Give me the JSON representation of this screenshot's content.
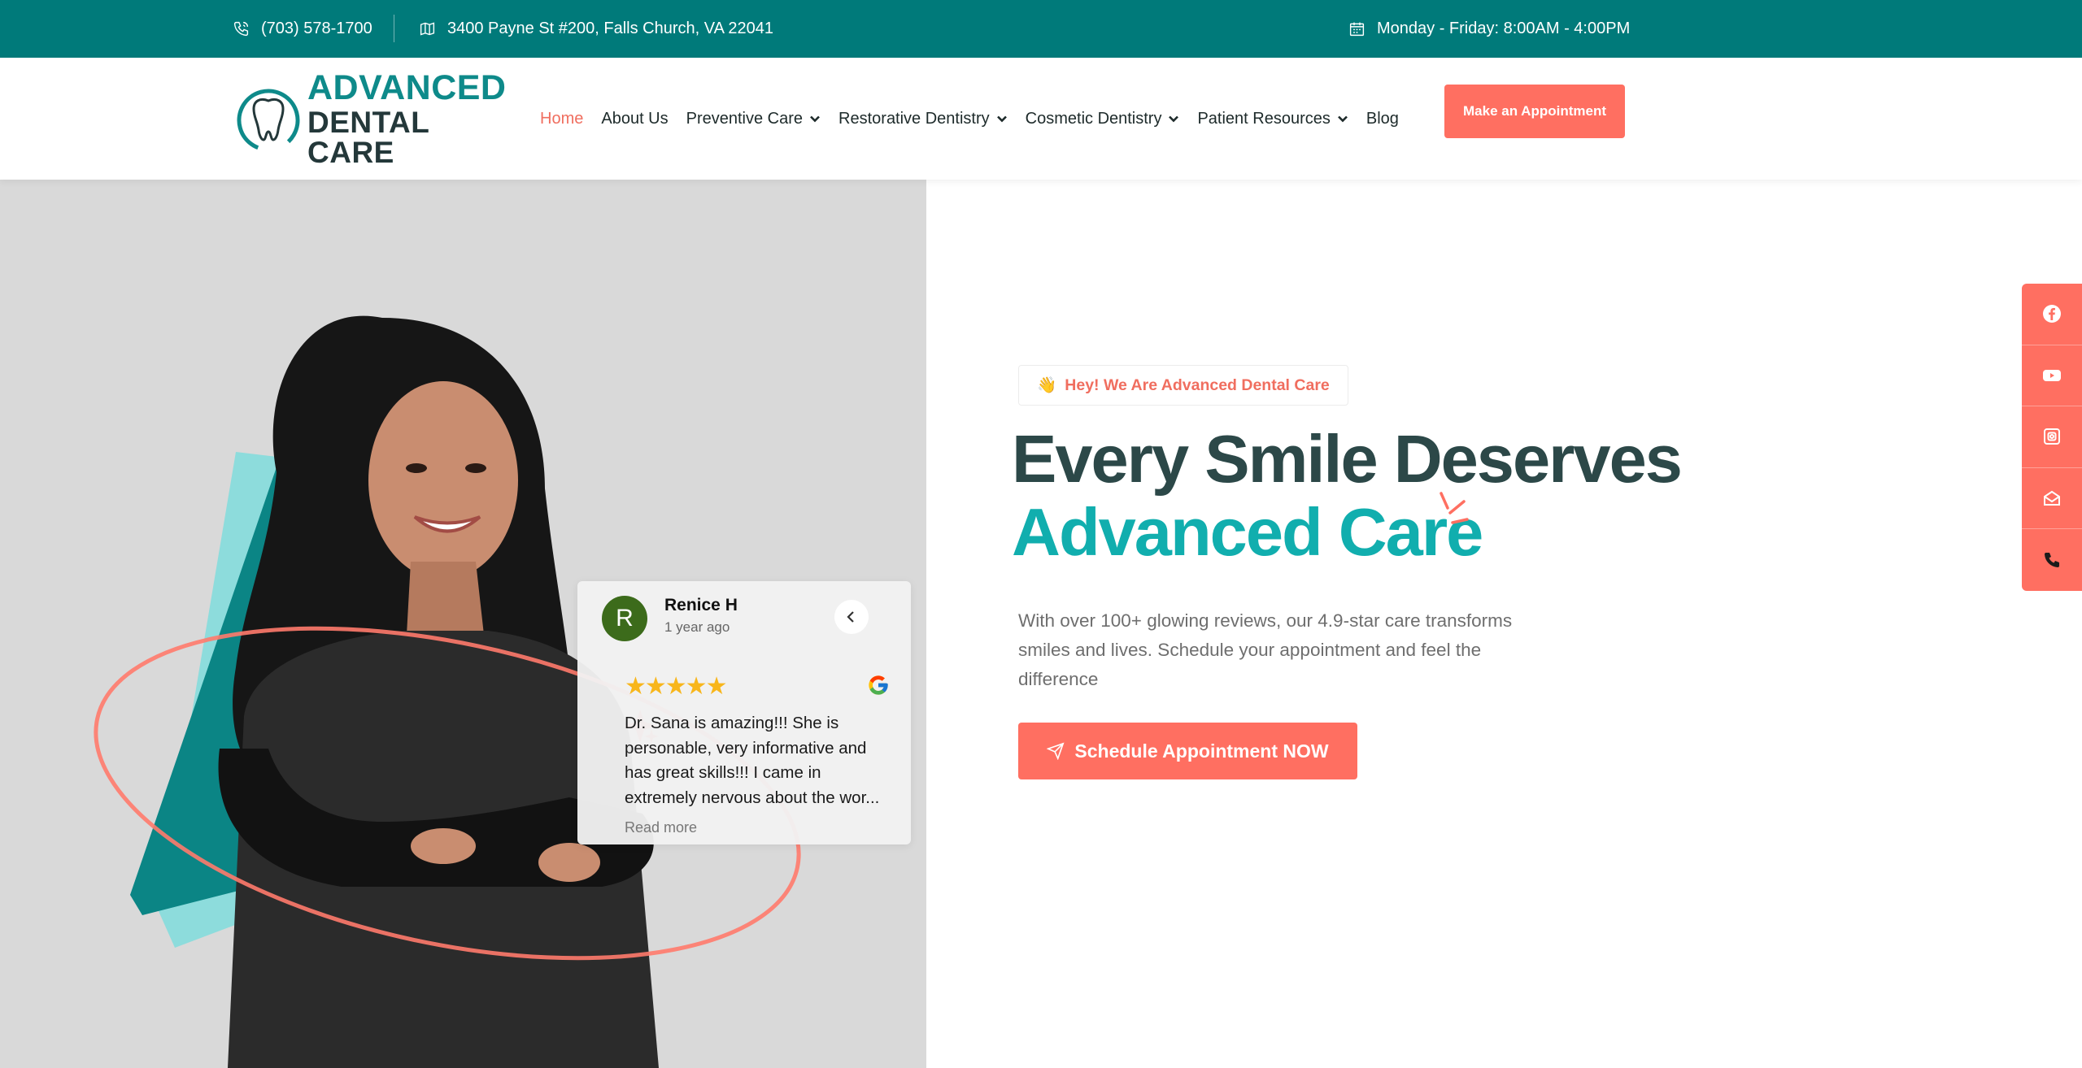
{
  "topbar": {
    "phone": "(703) 578-1700",
    "address": "3400 Payne St #200, Falls Church, VA 22041",
    "hours": "Monday - Friday: 8:00AM - 4:00PM"
  },
  "logo": {
    "line1": "ADVANCED",
    "line2": "DENTAL CARE"
  },
  "nav": {
    "items": [
      {
        "label": "Home"
      },
      {
        "label": "About Us"
      },
      {
        "label": "Preventive Care"
      },
      {
        "label": "Restorative Dentistry"
      },
      {
        "label": "Cosmetic Dentistry"
      },
      {
        "label": "Patient Resources"
      },
      {
        "label": "Blog"
      }
    ],
    "cta": "Make an Appointment"
  },
  "review": {
    "initial": "R",
    "name": "Renice H",
    "date": "1 year ago",
    "stars": "★★★★★",
    "text": "Dr. Sana is amazing!!! She is personable, very informative and has great skills!!! I came in extremely nervous about the wor...",
    "more": "Read more"
  },
  "hero": {
    "tag": "Hey! We Are Advanced Dental Care",
    "tag_emoji": "👋",
    "title_line1": "Every Smile Deserves",
    "title_line2": "Advanced Care",
    "lead": "With over 100+ glowing reviews, our 4.9-star care transforms smiles and lives. Schedule your appointment and feel the difference",
    "cta": "Schedule Appointment NOW"
  },
  "social": [
    "facebook-icon",
    "youtube-icon",
    "instagram-icon",
    "email-icon",
    "phone-icon"
  ],
  "colors": {
    "teal": "#007a7a",
    "accent": "#ff6f61",
    "heading": "#2c4848",
    "heading_accent": "#11aeae"
  }
}
